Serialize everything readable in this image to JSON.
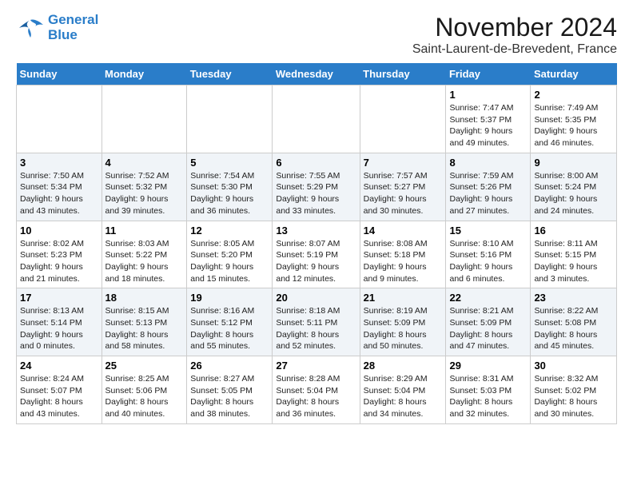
{
  "logo": {
    "line1": "General",
    "line2": "Blue"
  },
  "title": "November 2024",
  "subtitle": "Saint-Laurent-de-Brevedent, France",
  "headers": [
    "Sunday",
    "Monday",
    "Tuesday",
    "Wednesday",
    "Thursday",
    "Friday",
    "Saturday"
  ],
  "weeks": [
    [
      {
        "day": "",
        "info": ""
      },
      {
        "day": "",
        "info": ""
      },
      {
        "day": "",
        "info": ""
      },
      {
        "day": "",
        "info": ""
      },
      {
        "day": "",
        "info": ""
      },
      {
        "day": "1",
        "info": "Sunrise: 7:47 AM\nSunset: 5:37 PM\nDaylight: 9 hours\nand 49 minutes."
      },
      {
        "day": "2",
        "info": "Sunrise: 7:49 AM\nSunset: 5:35 PM\nDaylight: 9 hours\nand 46 minutes."
      }
    ],
    [
      {
        "day": "3",
        "info": "Sunrise: 7:50 AM\nSunset: 5:34 PM\nDaylight: 9 hours\nand 43 minutes."
      },
      {
        "day": "4",
        "info": "Sunrise: 7:52 AM\nSunset: 5:32 PM\nDaylight: 9 hours\nand 39 minutes."
      },
      {
        "day": "5",
        "info": "Sunrise: 7:54 AM\nSunset: 5:30 PM\nDaylight: 9 hours\nand 36 minutes."
      },
      {
        "day": "6",
        "info": "Sunrise: 7:55 AM\nSunset: 5:29 PM\nDaylight: 9 hours\nand 33 minutes."
      },
      {
        "day": "7",
        "info": "Sunrise: 7:57 AM\nSunset: 5:27 PM\nDaylight: 9 hours\nand 30 minutes."
      },
      {
        "day": "8",
        "info": "Sunrise: 7:59 AM\nSunset: 5:26 PM\nDaylight: 9 hours\nand 27 minutes."
      },
      {
        "day": "9",
        "info": "Sunrise: 8:00 AM\nSunset: 5:24 PM\nDaylight: 9 hours\nand 24 minutes."
      }
    ],
    [
      {
        "day": "10",
        "info": "Sunrise: 8:02 AM\nSunset: 5:23 PM\nDaylight: 9 hours\nand 21 minutes."
      },
      {
        "day": "11",
        "info": "Sunrise: 8:03 AM\nSunset: 5:22 PM\nDaylight: 9 hours\nand 18 minutes."
      },
      {
        "day": "12",
        "info": "Sunrise: 8:05 AM\nSunset: 5:20 PM\nDaylight: 9 hours\nand 15 minutes."
      },
      {
        "day": "13",
        "info": "Sunrise: 8:07 AM\nSunset: 5:19 PM\nDaylight: 9 hours\nand 12 minutes."
      },
      {
        "day": "14",
        "info": "Sunrise: 8:08 AM\nSunset: 5:18 PM\nDaylight: 9 hours\nand 9 minutes."
      },
      {
        "day": "15",
        "info": "Sunrise: 8:10 AM\nSunset: 5:16 PM\nDaylight: 9 hours\nand 6 minutes."
      },
      {
        "day": "16",
        "info": "Sunrise: 8:11 AM\nSunset: 5:15 PM\nDaylight: 9 hours\nand 3 minutes."
      }
    ],
    [
      {
        "day": "17",
        "info": "Sunrise: 8:13 AM\nSunset: 5:14 PM\nDaylight: 9 hours\nand 0 minutes."
      },
      {
        "day": "18",
        "info": "Sunrise: 8:15 AM\nSunset: 5:13 PM\nDaylight: 8 hours\nand 58 minutes."
      },
      {
        "day": "19",
        "info": "Sunrise: 8:16 AM\nSunset: 5:12 PM\nDaylight: 8 hours\nand 55 minutes."
      },
      {
        "day": "20",
        "info": "Sunrise: 8:18 AM\nSunset: 5:11 PM\nDaylight: 8 hours\nand 52 minutes."
      },
      {
        "day": "21",
        "info": "Sunrise: 8:19 AM\nSunset: 5:09 PM\nDaylight: 8 hours\nand 50 minutes."
      },
      {
        "day": "22",
        "info": "Sunrise: 8:21 AM\nSunset: 5:09 PM\nDaylight: 8 hours\nand 47 minutes."
      },
      {
        "day": "23",
        "info": "Sunrise: 8:22 AM\nSunset: 5:08 PM\nDaylight: 8 hours\nand 45 minutes."
      }
    ],
    [
      {
        "day": "24",
        "info": "Sunrise: 8:24 AM\nSunset: 5:07 PM\nDaylight: 8 hours\nand 43 minutes."
      },
      {
        "day": "25",
        "info": "Sunrise: 8:25 AM\nSunset: 5:06 PM\nDaylight: 8 hours\nand 40 minutes."
      },
      {
        "day": "26",
        "info": "Sunrise: 8:27 AM\nSunset: 5:05 PM\nDaylight: 8 hours\nand 38 minutes."
      },
      {
        "day": "27",
        "info": "Sunrise: 8:28 AM\nSunset: 5:04 PM\nDaylight: 8 hours\nand 36 minutes."
      },
      {
        "day": "28",
        "info": "Sunrise: 8:29 AM\nSunset: 5:04 PM\nDaylight: 8 hours\nand 34 minutes."
      },
      {
        "day": "29",
        "info": "Sunrise: 8:31 AM\nSunset: 5:03 PM\nDaylight: 8 hours\nand 32 minutes."
      },
      {
        "day": "30",
        "info": "Sunrise: 8:32 AM\nSunset: 5:02 PM\nDaylight: 8 hours\nand 30 minutes."
      }
    ]
  ]
}
